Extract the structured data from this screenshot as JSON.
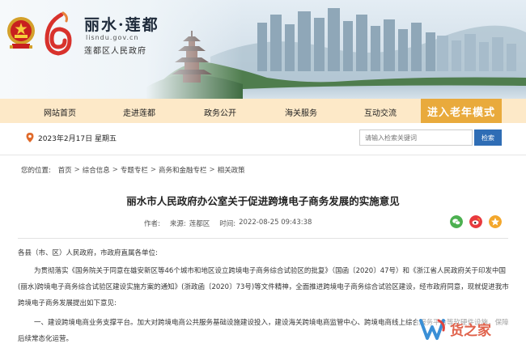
{
  "header": {
    "site_title": "丽水·莲都",
    "domain": "lisndu.gov.cn",
    "subtitle": "莲都区人民政府"
  },
  "nav": {
    "items": [
      "网站首页",
      "走进莲都",
      "政务公开",
      "海关服务",
      "互动交流"
    ],
    "elder_mode": "进入老年模式"
  },
  "date": "2023年2月17日 星期五",
  "search": {
    "placeholder": "请输入检索关键词",
    "button": "检索"
  },
  "breadcrumb": {
    "prefix": "您的位置:",
    "items": [
      "首页",
      "综合信息",
      "专题专栏",
      "商务和金融专栏",
      "相关政策"
    ]
  },
  "article": {
    "title": "丽水市人民政府办公室关于促进跨境电子商务发展的实施意见",
    "author_label": "作者:",
    "source_label": "来源:",
    "source_value": "莲都区",
    "time_label": "时间:",
    "time_value": "2022-08-25 09:43:38",
    "paragraphs": [
      "各县（市、区）人民政府，市政府直属各单位:",
      "为贯彻落实《国务院关于同意在雄安新区等46个城市和地区设立跨境电子商务综合试验区的批复》（国函〔2020〕47号）和《浙江省人民政府关于印发中国",
      "(丽水)跨境电子商务综合试验区建设实施方案的通知》(浙政函〔2020〕73号)等文件精神，全面推进跨境电子商务综合试验区建设，经市政府同意，现就促进我市",
      "跨境电子商务发展提出如下意见:",
      "一、建设跨境电商业务支撑平台。加大对跨境电商公共服务基础设施建设投入，建设海关跨境电商监管中心、跨境电商线上综合服务平台等软硬件设施，保障",
      "后续常态化运营。"
    ]
  },
  "watermark": {
    "text": "货之家"
  },
  "colors": {
    "nav_bg": "#fde9c8",
    "elder_bg": "#e9aa3c",
    "search_btn": "#2f6db5",
    "wechat": "#4cb050",
    "weibo": "#e8393e"
  },
  "icons": [
    "national-emblem-icon",
    "lishui-logo-icon",
    "location-pin-icon",
    "wechat-icon",
    "weibo-icon",
    "qzone-icon"
  ]
}
